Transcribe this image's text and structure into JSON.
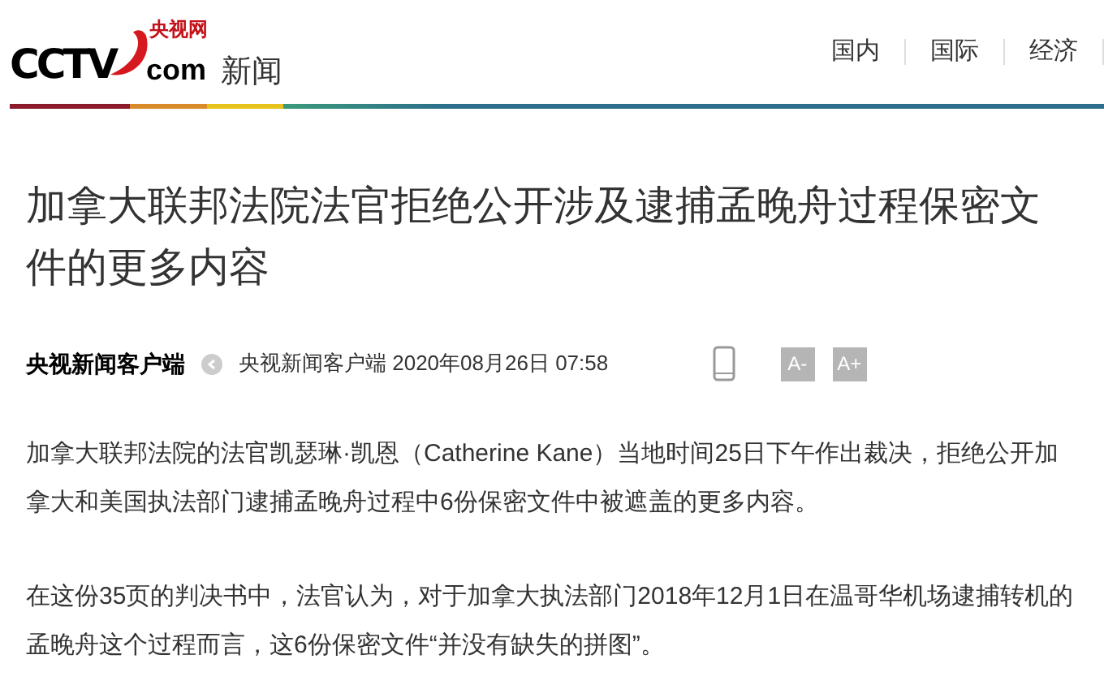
{
  "header": {
    "logo": {
      "main": "CCTV",
      "domain": "com",
      "cn": "央视网"
    },
    "section": "新闻",
    "nav": [
      {
        "label": "国内"
      },
      {
        "label": "国际"
      },
      {
        "label": "经济"
      }
    ]
  },
  "article": {
    "title": "加拿大联邦法院法官拒绝公开涉及逮捕孟晚舟过程保密文件的更多内容",
    "source": "央视新闻客户端",
    "meta": "央视新闻客户端 2020年08月26日 07:58",
    "font_buttons": [
      "A-",
      "A+"
    ],
    "paragraphs": [
      "加拿大联邦法院的法官凯瑟琳·凯恩（Catherine Kane）当地时间25日下午作出裁决，拒绝公开加拿大和美国执法部门逮捕孟晚舟过程中6份保密文件中被遮盖的更多内容。",
      "在这份35页的判决书中，法官认为，对于加拿大执法部门2018年12月1日在温哥华机场逮捕转机的孟晚舟这个过程而言，这6份保密文件“并没有缺失的拼图”。"
    ]
  }
}
